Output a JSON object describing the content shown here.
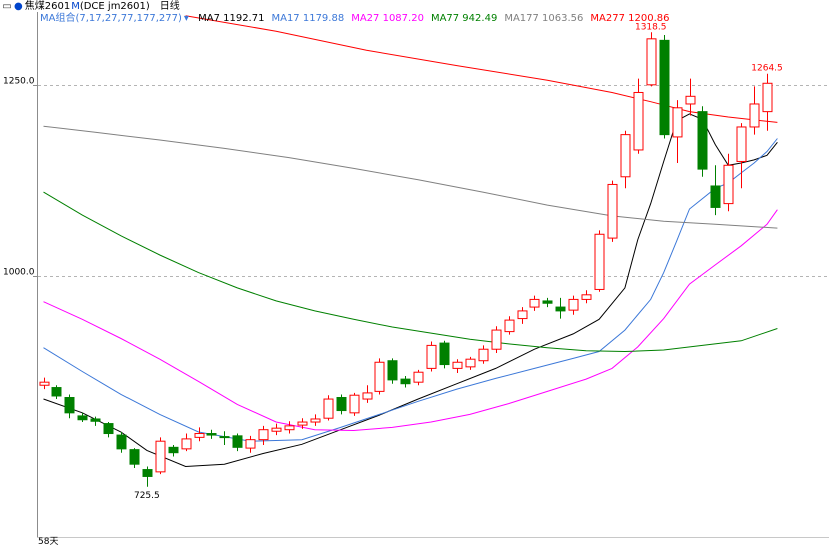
{
  "header": {
    "icon": "window-toggle-icon",
    "symbol": "焦煤2601",
    "badge": "M",
    "exchange_code": "(DCE jm2601)",
    "period": "日线",
    "ma_menu": "MA组合(7,17,27,77,177,277)",
    "ma_menu_icon": "dropdown-arrow-icon"
  },
  "colors": {
    "up": "#ff0000",
    "down": "#008000",
    "ma7": "#000000",
    "ma17": "#3c78d8",
    "ma27": "#ff00ff",
    "ma77": "#008000",
    "ma177": "#808080",
    "ma277": "#ff0000"
  },
  "chart_data": {
    "type": "candlestick",
    "ylim": [
      660,
      1345
    ],
    "yticks": [
      1000.0,
      1250.0
    ],
    "ytick_labels": [
      "1000.0",
      "1250.0"
    ],
    "grid": true,
    "bottom_label": "58天",
    "annotations": [
      {
        "text": "1318.5",
        "bar": 47,
        "value": 1318.5
      },
      {
        "text": "1264.5",
        "bar": 56,
        "value": 1264.5
      },
      {
        "text": "725.5",
        "bar": 8,
        "value": 725.5
      }
    ],
    "legend": [
      {
        "name": "MA7",
        "value": "1192.71",
        "color": "#000000"
      },
      {
        "name": "MA17",
        "value": "1179.88",
        "color": "#3c78d8"
      },
      {
        "name": "MA27",
        "value": "1087.20",
        "color": "#ff00ff"
      },
      {
        "name": "MA77",
        "value": "942.49",
        "color": "#008000"
      },
      {
        "name": "MA177",
        "value": "1063.56",
        "color": "#808080"
      },
      {
        "name": "MA277",
        "value": "1200.86",
        "color": "#ff0000"
      }
    ],
    "candles": [
      [
        858,
        868,
        853,
        862
      ],
      [
        855,
        858,
        840,
        844
      ],
      [
        842,
        846,
        815,
        822
      ],
      [
        818,
        822,
        810,
        813
      ],
      [
        814,
        817,
        805,
        811
      ],
      [
        808,
        810,
        790,
        795
      ],
      [
        793,
        797,
        770,
        775
      ],
      [
        774,
        776,
        750,
        755
      ],
      [
        748,
        752,
        725.5,
        739
      ],
      [
        745,
        790,
        742,
        785
      ],
      [
        777,
        780,
        765,
        770
      ],
      [
        775,
        795,
        772,
        788
      ],
      [
        790,
        803,
        785,
        795
      ],
      [
        795,
        800,
        788,
        793
      ],
      [
        791,
        798,
        780,
        790
      ],
      [
        792,
        795,
        772,
        777
      ],
      [
        776,
        792,
        770,
        787
      ],
      [
        787,
        805,
        780,
        800
      ],
      [
        798,
        808,
        793,
        802
      ],
      [
        800,
        811,
        795,
        805
      ],
      [
        806,
        815,
        801,
        810
      ],
      [
        810,
        820,
        805,
        814
      ],
      [
        815,
        845,
        812,
        840
      ],
      [
        842,
        846,
        820,
        825
      ],
      [
        822,
        848,
        818,
        845
      ],
      [
        840,
        858,
        835,
        848
      ],
      [
        850,
        893,
        846,
        888
      ],
      [
        890,
        893,
        860,
        865
      ],
      [
        866,
        870,
        855,
        860
      ],
      [
        862,
        878,
        858,
        875
      ],
      [
        880,
        915,
        876,
        910
      ],
      [
        913,
        916,
        880,
        885
      ],
      [
        880,
        892,
        874,
        888
      ],
      [
        882,
        895,
        878,
        892
      ],
      [
        890,
        910,
        886,
        905
      ],
      [
        905,
        935,
        900,
        930
      ],
      [
        928,
        948,
        924,
        943
      ],
      [
        945,
        960,
        938,
        955
      ],
      [
        960,
        975,
        955,
        970
      ],
      [
        968,
        972,
        960,
        965
      ],
      [
        960,
        972,
        945,
        955
      ],
      [
        956,
        975,
        950,
        970
      ],
      [
        970,
        982,
        965,
        976
      ],
      [
        983,
        1060,
        980,
        1055
      ],
      [
        1050,
        1125,
        1045,
        1120
      ],
      [
        1130,
        1190,
        1115,
        1185
      ],
      [
        1165,
        1258,
        1160,
        1240
      ],
      [
        1250,
        1318.5,
        1248,
        1310
      ],
      [
        1308,
        1315,
        1180,
        1185
      ],
      [
        1182,
        1230,
        1148,
        1220
      ],
      [
        1225,
        1258,
        1210,
        1235
      ],
      [
        1215,
        1222,
        1130,
        1140
      ],
      [
        1118,
        1145,
        1080,
        1090
      ],
      [
        1095,
        1160,
        1085,
        1145
      ],
      [
        1150,
        1200,
        1115,
        1195
      ],
      [
        1195,
        1248,
        1185,
        1225
      ],
      [
        1215,
        1264.5,
        1190,
        1252
      ]
    ],
    "ma_lines": {
      "ma7": [
        [
          0,
          840
        ],
        [
          3,
          822
        ],
        [
          6,
          797
        ],
        [
          8,
          773
        ],
        [
          11,
          752
        ],
        [
          14,
          755
        ],
        [
          17,
          769
        ],
        [
          20,
          781
        ],
        [
          23,
          800
        ],
        [
          26,
          819
        ],
        [
          29,
          840
        ],
        [
          32,
          860
        ],
        [
          35,
          880
        ],
        [
          38,
          905
        ],
        [
          41,
          925
        ],
        [
          43,
          944
        ],
        [
          45,
          985
        ],
        [
          46,
          1048
        ],
        [
          47,
          1095
        ],
        [
          48,
          1150
        ],
        [
          49,
          1203
        ],
        [
          50,
          1212
        ],
        [
          51,
          1205
        ],
        [
          52,
          1172
        ],
        [
          53,
          1145
        ],
        [
          54,
          1148
        ],
        [
          55,
          1152
        ],
        [
          56,
          1158
        ],
        [
          56.8,
          1175
        ]
      ],
      "ma17": [
        [
          0,
          907
        ],
        [
          3,
          876
        ],
        [
          6,
          846
        ],
        [
          9,
          820
        ],
        [
          12,
          797
        ],
        [
          16,
          785
        ],
        [
          20,
          787
        ],
        [
          23,
          803
        ],
        [
          26,
          820
        ],
        [
          29,
          837
        ],
        [
          32,
          853
        ],
        [
          35,
          867
        ],
        [
          38,
          880
        ],
        [
          41,
          893
        ],
        [
          43,
          902
        ],
        [
          45,
          930
        ],
        [
          47,
          970
        ],
        [
          48,
          1005
        ],
        [
          49,
          1046
        ],
        [
          50,
          1088
        ],
        [
          52,
          1115
        ],
        [
          53,
          1122
        ],
        [
          54,
          1135
        ],
        [
          55,
          1148
        ],
        [
          56,
          1163
        ],
        [
          56.8,
          1180
        ]
      ],
      "ma27": [
        [
          0,
          967
        ],
        [
          3,
          944
        ],
        [
          6,
          919
        ],
        [
          9,
          892
        ],
        [
          12,
          863
        ],
        [
          15,
          833
        ],
        [
          18,
          810
        ],
        [
          21,
          800
        ],
        [
          24,
          799
        ],
        [
          27,
          803
        ],
        [
          30,
          810
        ],
        [
          33,
          820
        ],
        [
          36,
          834
        ],
        [
          39,
          850
        ],
        [
          42,
          866
        ],
        [
          44,
          880
        ],
        [
          46,
          908
        ],
        [
          48,
          945
        ],
        [
          50,
          990
        ],
        [
          52,
          1015
        ],
        [
          54,
          1040
        ],
        [
          56,
          1068
        ],
        [
          56.8,
          1087
        ]
      ],
      "ma77": [
        [
          0,
          1110
        ],
        [
          3,
          1080
        ],
        [
          6,
          1053
        ],
        [
          9,
          1028
        ],
        [
          12,
          1005
        ],
        [
          15,
          985
        ],
        [
          18,
          968
        ],
        [
          21,
          955
        ],
        [
          24,
          944
        ],
        [
          27,
          934
        ],
        [
          30,
          926
        ],
        [
          33,
          918
        ],
        [
          36,
          912
        ],
        [
          39,
          907
        ],
        [
          42,
          903
        ],
        [
          45,
          902
        ],
        [
          48,
          904
        ],
        [
          51,
          910
        ],
        [
          54,
          916
        ],
        [
          56.8,
          932
        ]
      ],
      "ma177": [
        [
          0,
          1196
        ],
        [
          4,
          1188
        ],
        [
          9,
          1178
        ],
        [
          14,
          1167
        ],
        [
          19,
          1155
        ],
        [
          24,
          1141
        ],
        [
          29,
          1126
        ],
        [
          34,
          1110
        ],
        [
          39,
          1093
        ],
        [
          44,
          1079
        ],
        [
          48,
          1072
        ],
        [
          52,
          1068
        ],
        [
          56.8,
          1063
        ]
      ],
      "ma277": [
        [
          11,
          1340
        ],
        [
          18,
          1320
        ],
        [
          25,
          1295
        ],
        [
          32,
          1275
        ],
        [
          39,
          1256
        ],
        [
          44,
          1240
        ],
        [
          47,
          1228
        ],
        [
          50,
          1215
        ],
        [
          53,
          1208
        ],
        [
          56.8,
          1201
        ]
      ]
    }
  }
}
